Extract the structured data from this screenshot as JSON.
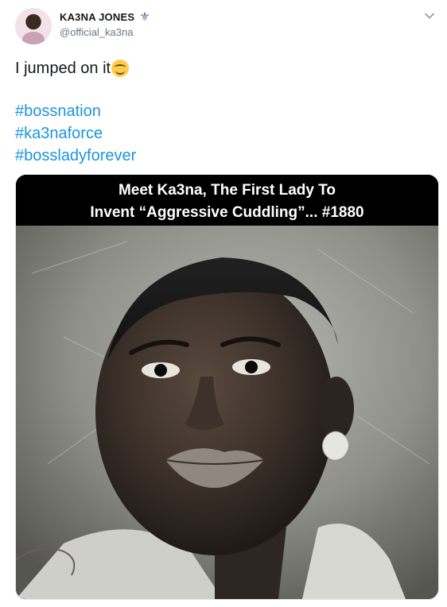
{
  "author": {
    "display_name": "KA3NA JONES",
    "badge_icon": "fleur-de-lis-icon",
    "handle": "@official_ka3na"
  },
  "tweet": {
    "text": "I jumped on it",
    "emoji": "smiling-face-icon",
    "hashtags": [
      "#bossnation",
      "#ka3naforce",
      "#bossladyforever"
    ]
  },
  "media": {
    "caption_line1": "Meet Ka3na, The First Lady To",
    "caption_line2": "Invent “Aggressive Cuddling”... #1880"
  },
  "colors": {
    "link": "#1b95e0",
    "badge": "#7d5ba6",
    "secondary_text": "#657786"
  }
}
